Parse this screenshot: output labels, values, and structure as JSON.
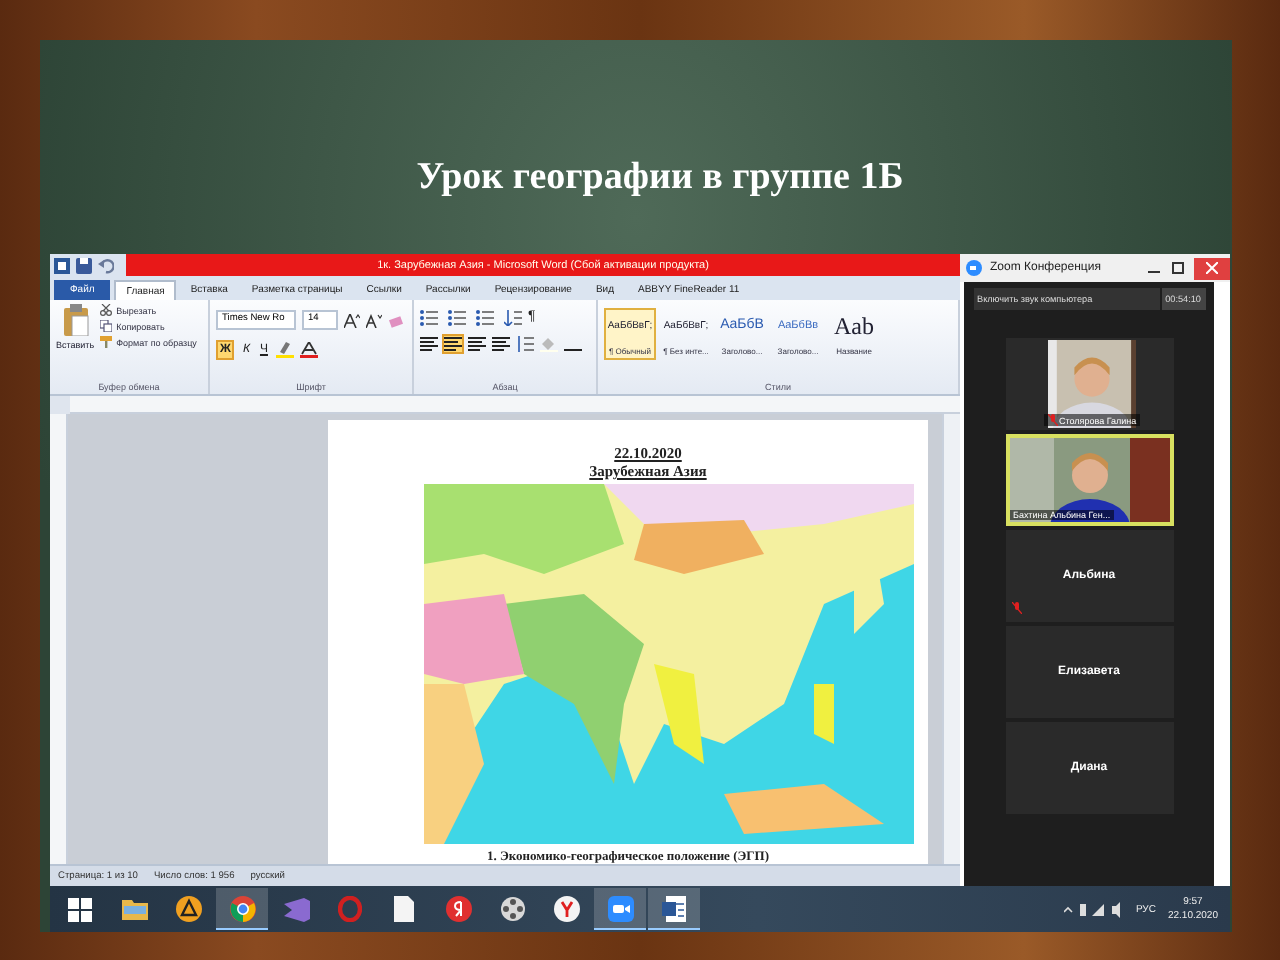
{
  "slide": {
    "title": "Урок географии в группе 1Б"
  },
  "word": {
    "title": "1к. Зарубежная Азия - Microsoft Word (Сбой активации продукта)",
    "tabs": [
      {
        "label": "Файл",
        "kind": "file",
        "selected": false
      },
      {
        "label": "Главная",
        "kind": "tab",
        "selected": true
      },
      {
        "label": "Вставка",
        "kind": "tab",
        "selected": false
      },
      {
        "label": "Разметка страницы",
        "kind": "tab",
        "selected": false
      },
      {
        "label": "Ссылки",
        "kind": "tab",
        "selected": false
      },
      {
        "label": "Рассылки",
        "kind": "tab",
        "selected": false
      },
      {
        "label": "Рецензирование",
        "kind": "tab",
        "selected": false
      },
      {
        "label": "Вид",
        "kind": "tab",
        "selected": false
      },
      {
        "label": "ABBYY FineReader 11",
        "kind": "tab",
        "selected": false
      }
    ],
    "clipboard": {
      "paste": "Вставить",
      "actions": [
        "Вырезать",
        "Копировать",
        "Формат по образцу"
      ]
    },
    "font": {
      "name": "Times New Ro",
      "size": "14",
      "format_buttons": [
        "Ж",
        "К",
        "Ч"
      ]
    },
    "show_marks": "¶",
    "styles": [
      {
        "sample": "AaБбВвГ;",
        "name": "¶ Обычный",
        "selected": true
      },
      {
        "sample": "AaБбВвГ;",
        "name": "¶ Без инте...",
        "selected": false
      },
      {
        "sample": "AaБбВ",
        "name": "Заголово...",
        "selected": false
      },
      {
        "sample": "AaБбВв",
        "name": "Заголово...",
        "selected": false
      },
      {
        "sample": "Aab",
        "name": "Название",
        "selected": false
      }
    ],
    "groups": [
      "Буфер обмена",
      "Шрифт",
      "Абзац",
      "Стили"
    ],
    "document": {
      "date": "22.10.2020",
      "heading": "Зарубежная Азия",
      "item": "1.  Экономико-географическое положение (ЭГП)"
    },
    "status_bar": [
      "Страница: 1 из 10",
      "Число слов: 1 956",
      "русский"
    ]
  },
  "zoom": {
    "title": "Zoom Конференция",
    "audio_button": "Включить звук компьютера",
    "timer": "00:54:10",
    "participants": [
      {
        "name": "Столярова Галина",
        "video": true,
        "muted": true,
        "speaking": false
      },
      {
        "name": "Бахтина Альбина Ген...",
        "video": true,
        "muted": false,
        "speaking": true
      },
      {
        "name": "Альбина",
        "video": false,
        "muted": true,
        "speaking": false
      },
      {
        "name": "Елизавета",
        "video": false,
        "muted": false,
        "speaking": false
      },
      {
        "name": "Диана",
        "video": false,
        "muted": false,
        "speaking": false
      }
    ]
  },
  "taskbar": {
    "apps": [
      {
        "kind": "start",
        "selected": false
      },
      {
        "kind": "folder",
        "selected": false
      },
      {
        "kind": "player",
        "selected": false
      },
      {
        "kind": "chrome",
        "selected": true
      },
      {
        "kind": "studio",
        "selected": false
      },
      {
        "kind": "opera",
        "selected": false
      },
      {
        "kind": "file",
        "selected": false
      },
      {
        "kind": "yandex",
        "selected": false
      },
      {
        "kind": "reel",
        "selected": false
      },
      {
        "kind": "ybrowser",
        "selected": false
      },
      {
        "kind": "zoom",
        "selected": true
      },
      {
        "kind": "word",
        "selected": true
      }
    ],
    "language": "РУС",
    "time": "9:57",
    "date": "22.10.2020"
  }
}
